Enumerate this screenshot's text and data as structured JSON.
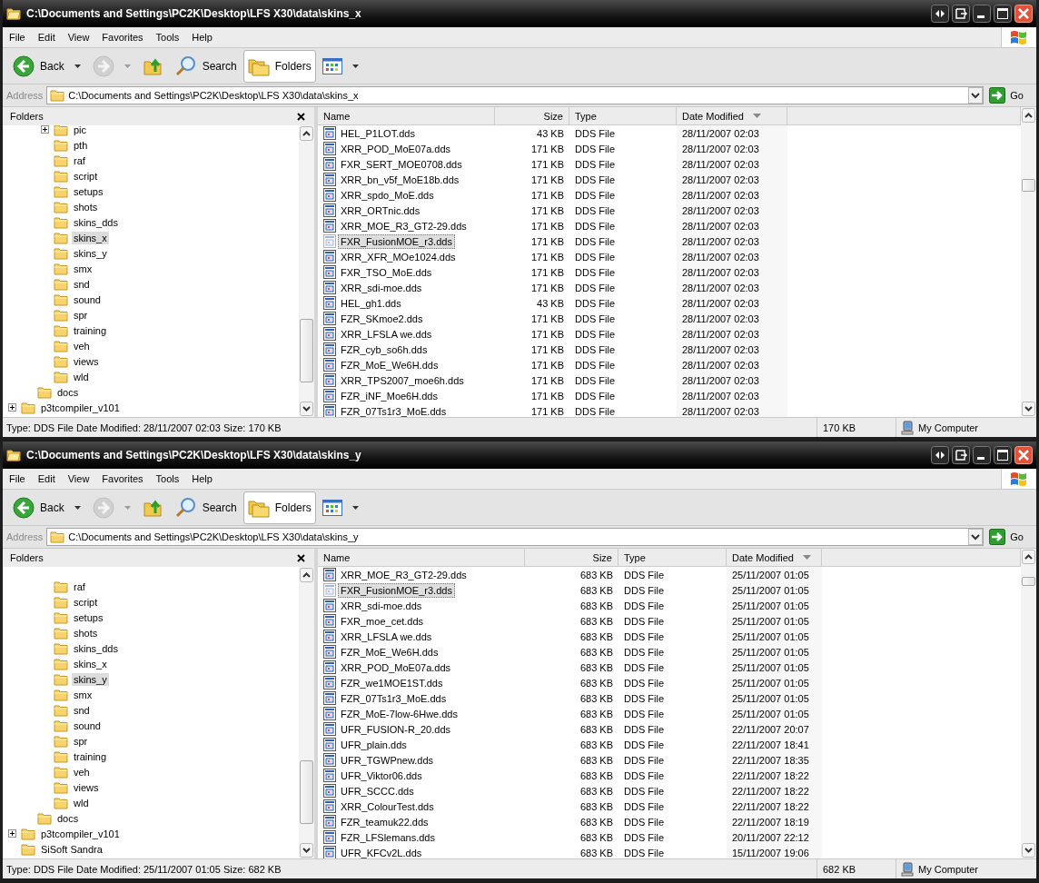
{
  "windows": [
    {
      "title": "C:\\Documents and Settings\\PC2K\\Desktop\\LFS X30\\data\\skins_x",
      "menu": [
        "File",
        "Edit",
        "View",
        "Favorites",
        "Tools",
        "Help"
      ],
      "toolbar": [
        {
          "kind": "back",
          "label": "Back",
          "dropdown": true,
          "disabled": false,
          "pressed": false
        },
        {
          "kind": "forward",
          "dropdown": true,
          "disabled": true,
          "pressed": false
        },
        {
          "kind": "up",
          "dropdown": false,
          "disabled": false,
          "pressed": false
        },
        {
          "kind": "search",
          "label": "Search",
          "dropdown": false,
          "disabled": false,
          "pressed": false
        },
        {
          "kind": "folders",
          "label": "Folders",
          "dropdown": false,
          "disabled": false,
          "pressed": true
        },
        {
          "kind": "views",
          "dropdown": true,
          "disabled": false,
          "pressed": false
        }
      ],
      "address": {
        "label": "Address",
        "value": "C:\\Documents and Settings\\PC2K\\Desktop\\LFS X30\\data\\skins_x"
      },
      "go": "Go",
      "folders_pane": {
        "title": "Folders",
        "tree": [
          {
            "children": [
              {
                "children": [
                  {
                    "label": "pic",
                    "expandable": true,
                    "selected": false
                  },
                  {
                    "label": "pth",
                    "expandable": false,
                    "selected": false
                  },
                  {
                    "label": "raf",
                    "expandable": false,
                    "selected": false
                  },
                  {
                    "label": "script",
                    "expandable": false,
                    "selected": false
                  },
                  {
                    "label": "setups",
                    "expandable": false,
                    "selected": false
                  },
                  {
                    "label": "shots",
                    "expandable": false,
                    "selected": false
                  },
                  {
                    "label": "skins_dds",
                    "expandable": false,
                    "selected": false
                  },
                  {
                    "label": "skins_x",
                    "expandable": false,
                    "selected": true
                  },
                  {
                    "label": "skins_y",
                    "expandable": false,
                    "selected": false
                  },
                  {
                    "label": "smx",
                    "expandable": false,
                    "selected": false
                  },
                  {
                    "label": "snd",
                    "expandable": false,
                    "selected": false
                  },
                  {
                    "label": "sound",
                    "expandable": false,
                    "selected": false
                  },
                  {
                    "label": "spr",
                    "expandable": false,
                    "selected": false
                  },
                  {
                    "label": "training",
                    "expandable": false,
                    "selected": false
                  },
                  {
                    "label": "veh",
                    "expandable": false,
                    "selected": false
                  },
                  {
                    "label": "views",
                    "expandable": false,
                    "selected": false
                  },
                  {
                    "label": "wld",
                    "expandable": false,
                    "selected": false
                  }
                ]
              },
              {
                "label": "docs",
                "expandable": false,
                "selected": false
              }
            ]
          },
          {
            "label": "p3tcompiler_v101",
            "expandable": true,
            "selected": false
          }
        ]
      },
      "columns": [
        {
          "label": "Name",
          "sorted": false
        },
        {
          "label": "Size",
          "sorted": false
        },
        {
          "label": "Type",
          "sorted": false
        },
        {
          "label": "Date Modified",
          "sorted": true
        }
      ],
      "files": [
        {
          "name": "HEL_P1LOT.dds",
          "size": "43 KB",
          "type": "DDS File",
          "date": "28/11/2007 02:03",
          "selected": false
        },
        {
          "name": "XRR_POD_MoE07a.dds",
          "size": "171 KB",
          "type": "DDS File",
          "date": "28/11/2007 02:03",
          "selected": false
        },
        {
          "name": "FXR_SERT_MOE0708.dds",
          "size": "171 KB",
          "type": "DDS File",
          "date": "28/11/2007 02:03",
          "selected": false
        },
        {
          "name": "XRR_bn_v5f_MoE18b.dds",
          "size": "171 KB",
          "type": "DDS File",
          "date": "28/11/2007 02:03",
          "selected": false
        },
        {
          "name": "XRR_spdo_MoE.dds",
          "size": "171 KB",
          "type": "DDS File",
          "date": "28/11/2007 02:03",
          "selected": false
        },
        {
          "name": "XRR_ORTnic.dds",
          "size": "171 KB",
          "type": "DDS File",
          "date": "28/11/2007 02:03",
          "selected": false
        },
        {
          "name": "XRR_MOE_R3_GT2-29.dds",
          "size": "171 KB",
          "type": "DDS File",
          "date": "28/11/2007 02:03",
          "selected": false
        },
        {
          "name": "FXR_FusionMOE_r3.dds",
          "size": "171 KB",
          "type": "DDS File",
          "date": "28/11/2007 02:03",
          "selected": true
        },
        {
          "name": "XRR_XFR_MOe1024.dds",
          "size": "171 KB",
          "type": "DDS File",
          "date": "28/11/2007 02:03",
          "selected": false
        },
        {
          "name": "FXR_TSO_MoE.dds",
          "size": "171 KB",
          "type": "DDS File",
          "date": "28/11/2007 02:03",
          "selected": false
        },
        {
          "name": "XRR_sdi-moe.dds",
          "size": "171 KB",
          "type": "DDS File",
          "date": "28/11/2007 02:03",
          "selected": false
        },
        {
          "name": "HEL_gh1.dds",
          "size": "43 KB",
          "type": "DDS File",
          "date": "28/11/2007 02:03",
          "selected": false
        },
        {
          "name": "FZR_SKmoe2.dds",
          "size": "171 KB",
          "type": "DDS File",
          "date": "28/11/2007 02:03",
          "selected": false
        },
        {
          "name": "XRR_LFSLA we.dds",
          "size": "171 KB",
          "type": "DDS File",
          "date": "28/11/2007 02:03",
          "selected": false
        },
        {
          "name": "FZR_cyb_so6h.dds",
          "size": "171 KB",
          "type": "DDS File",
          "date": "28/11/2007 02:03",
          "selected": false
        },
        {
          "name": "FZR_MoE_We6H.dds",
          "size": "171 KB",
          "type": "DDS File",
          "date": "28/11/2007 02:03",
          "selected": false
        },
        {
          "name": "XRR_TPS2007_moe6h.dds",
          "size": "171 KB",
          "type": "DDS File",
          "date": "28/11/2007 02:03",
          "selected": false
        },
        {
          "name": "FZR_iNF_Moe6H.dds",
          "size": "171 KB",
          "type": "DDS File",
          "date": "28/11/2007 02:03",
          "selected": false
        },
        {
          "name": "FZR_07Ts1r3_MoE.dds",
          "size": "171 KB",
          "type": "DDS File",
          "date": "28/11/2007 02:03",
          "selected": false
        }
      ],
      "status": {
        "text": "Type: DDS File Date Modified: 28/11/2007 02:03 Size: 170 KB",
        "size": "170 KB",
        "zone": "My Computer"
      }
    },
    {
      "title": "C:\\Documents and Settings\\PC2K\\Desktop\\LFS X30\\data\\skins_y",
      "menu": [
        "File",
        "Edit",
        "View",
        "Favorites",
        "Tools",
        "Help"
      ],
      "toolbar": [
        {
          "kind": "back",
          "label": "Back",
          "dropdown": true,
          "disabled": false,
          "pressed": false
        },
        {
          "kind": "forward",
          "dropdown": true,
          "disabled": true,
          "pressed": false
        },
        {
          "kind": "up",
          "dropdown": false,
          "disabled": false,
          "pressed": false
        },
        {
          "kind": "search",
          "label": "Search",
          "dropdown": false,
          "disabled": false,
          "pressed": false
        },
        {
          "kind": "folders",
          "label": "Folders",
          "dropdown": false,
          "disabled": false,
          "pressed": true
        },
        {
          "kind": "views",
          "dropdown": true,
          "disabled": false,
          "pressed": false
        }
      ],
      "address": {
        "label": "Address",
        "value": "C:\\Documents and Settings\\PC2K\\Desktop\\LFS X30\\data\\skins_y"
      },
      "go": "Go",
      "folders_pane": {
        "title": "Folders",
        "tree": [
          {
            "children": [
              {
                "children": [
                  {
                    "label": "raf",
                    "expandable": false,
                    "selected": false
                  },
                  {
                    "label": "script",
                    "expandable": false,
                    "selected": false
                  },
                  {
                    "label": "setups",
                    "expandable": false,
                    "selected": false
                  },
                  {
                    "label": "shots",
                    "expandable": false,
                    "selected": false
                  },
                  {
                    "label": "skins_dds",
                    "expandable": false,
                    "selected": false
                  },
                  {
                    "label": "skins_x",
                    "expandable": false,
                    "selected": false
                  },
                  {
                    "label": "skins_y",
                    "expandable": false,
                    "selected": true
                  },
                  {
                    "label": "smx",
                    "expandable": false,
                    "selected": false
                  },
                  {
                    "label": "snd",
                    "expandable": false,
                    "selected": false
                  },
                  {
                    "label": "sound",
                    "expandable": false,
                    "selected": false
                  },
                  {
                    "label": "spr",
                    "expandable": false,
                    "selected": false
                  },
                  {
                    "label": "training",
                    "expandable": false,
                    "selected": false
                  },
                  {
                    "label": "veh",
                    "expandable": false,
                    "selected": false
                  },
                  {
                    "label": "views",
                    "expandable": false,
                    "selected": false
                  },
                  {
                    "label": "wld",
                    "expandable": false,
                    "selected": false
                  }
                ]
              },
              {
                "label": "docs",
                "expandable": false,
                "selected": false
              }
            ]
          },
          {
            "label": "p3tcompiler_v101",
            "expandable": true,
            "selected": false
          },
          {
            "label": "SiSoft Sandra",
            "expandable": false,
            "selected": false
          }
        ]
      },
      "columns": [
        {
          "label": "Name",
          "sorted": false
        },
        {
          "label": "Size",
          "sorted": false
        },
        {
          "label": "Type",
          "sorted": false
        },
        {
          "label": "Date Modified",
          "sorted": true
        }
      ],
      "files": [
        {
          "name": "XRR_MOE_R3_GT2-29.dds",
          "size": "683 KB",
          "type": "DDS File",
          "date": "25/11/2007 01:05",
          "selected": false
        },
        {
          "name": "FXR_FusionMOE_r3.dds",
          "size": "683 KB",
          "type": "DDS File",
          "date": "25/11/2007 01:05",
          "selected": true
        },
        {
          "name": "XRR_sdi-moe.dds",
          "size": "683 KB",
          "type": "DDS File",
          "date": "25/11/2007 01:05",
          "selected": false
        },
        {
          "name": "FXR_moe_cet.dds",
          "size": "683 KB",
          "type": "DDS File",
          "date": "25/11/2007 01:05",
          "selected": false
        },
        {
          "name": "XRR_LFSLA we.dds",
          "size": "683 KB",
          "type": "DDS File",
          "date": "25/11/2007 01:05",
          "selected": false
        },
        {
          "name": "FZR_MoE_We6H.dds",
          "size": "683 KB",
          "type": "DDS File",
          "date": "25/11/2007 01:05",
          "selected": false
        },
        {
          "name": "XRR_POD_MoE07a.dds",
          "size": "683 KB",
          "type": "DDS File",
          "date": "25/11/2007 01:05",
          "selected": false
        },
        {
          "name": "FZR_we1MOE1ST.dds",
          "size": "683 KB",
          "type": "DDS File",
          "date": "25/11/2007 01:05",
          "selected": false
        },
        {
          "name": "FZR_07Ts1r3_MoE.dds",
          "size": "683 KB",
          "type": "DDS File",
          "date": "25/11/2007 01:05",
          "selected": false
        },
        {
          "name": "FZR_MoE-7low-6Hwe.dds",
          "size": "683 KB",
          "type": "DDS File",
          "date": "25/11/2007 01:05",
          "selected": false
        },
        {
          "name": "UFR_FUSION-R_20.dds",
          "size": "683 KB",
          "type": "DDS File",
          "date": "22/11/2007 20:07",
          "selected": false
        },
        {
          "name": "UFR_plain.dds",
          "size": "683 KB",
          "type": "DDS File",
          "date": "22/11/2007 18:41",
          "selected": false
        },
        {
          "name": "UFR_TGWPnew.dds",
          "size": "683 KB",
          "type": "DDS File",
          "date": "22/11/2007 18:35",
          "selected": false
        },
        {
          "name": "UFR_Viktor06.dds",
          "size": "683 KB",
          "type": "DDS File",
          "date": "22/11/2007 18:22",
          "selected": false
        },
        {
          "name": "UFR_SCCC.dds",
          "size": "683 KB",
          "type": "DDS File",
          "date": "22/11/2007 18:22",
          "selected": false
        },
        {
          "name": "XRR_ColourTest.dds",
          "size": "683 KB",
          "type": "DDS File",
          "date": "22/11/2007 18:22",
          "selected": false
        },
        {
          "name": "FZR_teamuk22.dds",
          "size": "683 KB",
          "type": "DDS File",
          "date": "22/11/2007 18:19",
          "selected": false
        },
        {
          "name": "FZR_LFSlemans.dds",
          "size": "683 KB",
          "type": "DDS File",
          "date": "20/11/2007 22:12",
          "selected": false
        },
        {
          "name": "UFR_KFCv2L.dds",
          "size": "683 KB",
          "type": "DDS File",
          "date": "15/11/2007 19:06",
          "selected": false
        }
      ],
      "status": {
        "text": "Type: DDS File Date Modified: 25/11/2007 01:05 Size: 682 KB",
        "size": "682 KB",
        "zone": "My Computer"
      }
    }
  ]
}
